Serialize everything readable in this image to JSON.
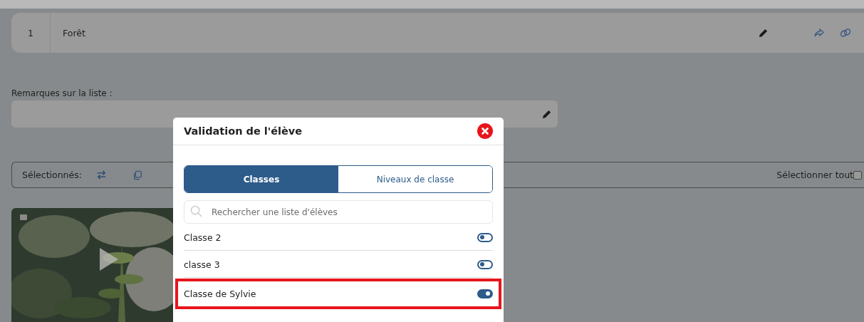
{
  "list_row": {
    "number": "1",
    "title": "Forêt"
  },
  "remarks": {
    "label": "Remarques sur la liste :"
  },
  "selection_bar": {
    "label": "Sélectionnés:",
    "select_all": {
      "label": "Sélectionner tout",
      "checked": false
    }
  },
  "dialog": {
    "title": "Validation de l'élève",
    "tabs": [
      {
        "label": "Classes",
        "selected": true
      },
      {
        "label": "Niveaux de classe",
        "selected": false
      }
    ],
    "search": {
      "placeholder": "Rechercher une liste d'élèves"
    },
    "items": [
      {
        "label": "Classe 2",
        "on": false,
        "highlighted": false
      },
      {
        "label": "classe 3",
        "on": false,
        "highlighted": false
      },
      {
        "label": "Classe de Sylvie",
        "on": true,
        "highlighted": true
      }
    ]
  }
}
